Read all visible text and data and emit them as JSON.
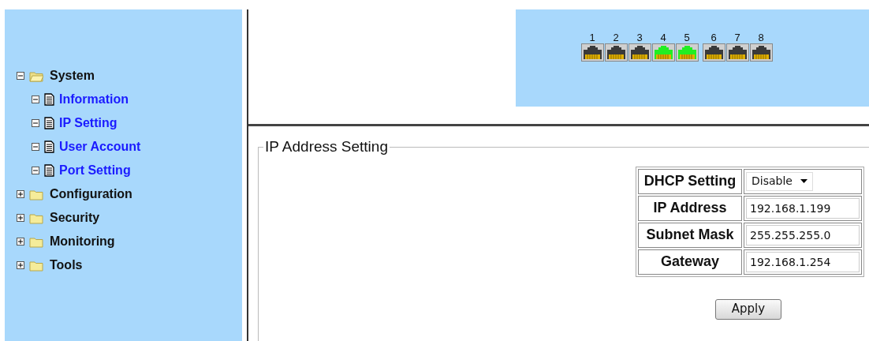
{
  "sidebar": {
    "tree": [
      {
        "label": "System",
        "expanded": true,
        "children": [
          {
            "label": "Information"
          },
          {
            "label": "IP Setting"
          },
          {
            "label": "User Account"
          },
          {
            "label": "Port Setting"
          }
        ]
      },
      {
        "label": "Configuration",
        "expanded": false
      },
      {
        "label": "Security",
        "expanded": false
      },
      {
        "label": "Monitoring",
        "expanded": false
      },
      {
        "label": "Tools",
        "expanded": false
      }
    ]
  },
  "ports": [
    {
      "label": "1",
      "link": false
    },
    {
      "label": "2",
      "link": false
    },
    {
      "label": "3",
      "link": false
    },
    {
      "label": "4",
      "link": true
    },
    {
      "label": "5",
      "link": true
    },
    {
      "label": "6",
      "link": false
    },
    {
      "label": "7",
      "link": false
    },
    {
      "label": "8",
      "link": false
    }
  ],
  "ip_settings": {
    "legend": "IP Address Setting",
    "rows": [
      {
        "kind": "select",
        "label": "DHCP Setting",
        "value": "Disable"
      },
      {
        "kind": "input",
        "label": "IP Address",
        "value": "192.168.1.199"
      },
      {
        "kind": "input",
        "label": "Subnet Mask",
        "value": "255.255.255.0"
      },
      {
        "kind": "input",
        "label": "Gateway",
        "value": "192.168.1.254"
      }
    ],
    "apply_button": "Apply"
  }
}
